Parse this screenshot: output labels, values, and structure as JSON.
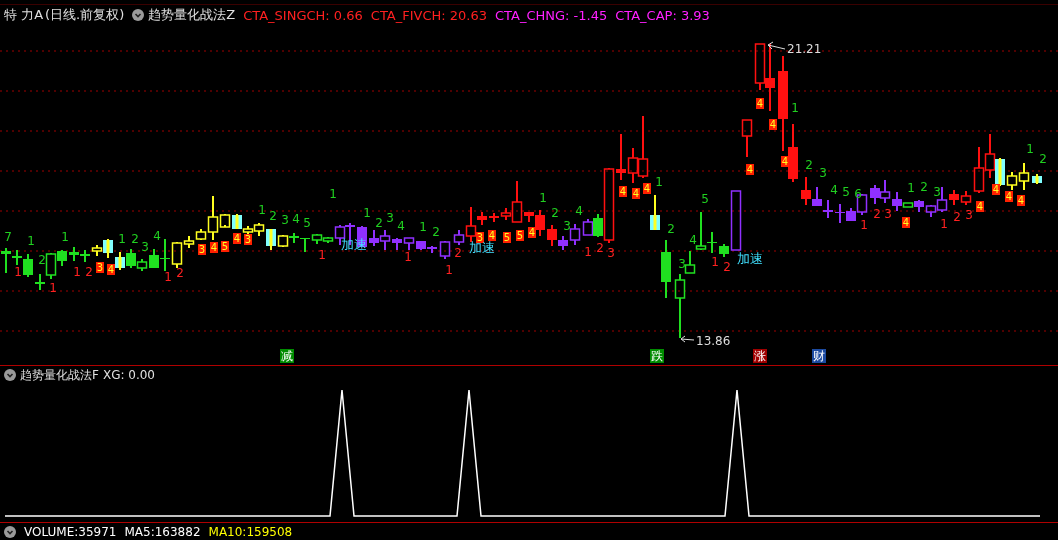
{
  "top_legend": {
    "stock": "特 力A",
    "period": "(日线.前复权)",
    "indicator": "趋势量化战法Z",
    "values": [
      {
        "text": "CTA_SINGCH: 0.66",
        "color": "#ff2020"
      },
      {
        "text": "CTA_FIVCH: 20.63",
        "color": "#ff2020"
      },
      {
        "text": "CTA_CHNG: -1.45",
        "color": "#ff20ff"
      },
      {
        "text": "CTA_CAP: 3.93",
        "color": "#ff20ff"
      }
    ]
  },
  "main_chart": {
    "high_label": "21.21",
    "low_label": "13.86",
    "up_counts": [
      "7",
      "1",
      "2",
      "1",
      "1",
      "2",
      "3",
      "4",
      "1",
      "2",
      "3",
      "4",
      "5",
      "1",
      "1",
      "2",
      "3",
      "4",
      "1",
      "2",
      "1",
      "2",
      "3",
      "4",
      "1",
      "2",
      "3",
      "4",
      "5",
      "1",
      "2",
      "3",
      "4",
      "5",
      "6",
      "1",
      "2",
      "3",
      "1",
      "2"
    ],
    "down_counts": [
      "1",
      "1",
      "1",
      "2",
      "1",
      "2",
      "1",
      "1",
      "1",
      "2",
      "1",
      "2",
      "3",
      "1",
      "2",
      "1",
      "2",
      "3",
      "1",
      "2",
      "3"
    ],
    "badges": [
      "3",
      "4",
      "3",
      "4",
      "5",
      "4",
      "3",
      "3",
      "4",
      "5",
      "5",
      "4",
      "4",
      "4",
      "4",
      "4",
      "4",
      "4",
      "4",
      "4",
      "4",
      "4",
      "4",
      "4"
    ],
    "signals": [
      "加速",
      "加速",
      "加速"
    ]
  },
  "markers": [
    {
      "text": "减",
      "color": "#008c00"
    },
    {
      "text": "跌",
      "color": "#008c00"
    },
    {
      "text": "涨",
      "color": "#a00000"
    },
    {
      "text": "财",
      "color": "#1c4aa0"
    }
  ],
  "sub_panel": {
    "title": "趋势量化战法F",
    "reading": "XG: 0.00"
  },
  "volume_bar": {
    "items": [
      {
        "text": "VOLUME:35971",
        "color": "#ffffff"
      },
      {
        "text": "MA5:163882",
        "color": "#ffffff"
      },
      {
        "text": "MA10:159508",
        "color": "#ffff00"
      }
    ]
  }
}
